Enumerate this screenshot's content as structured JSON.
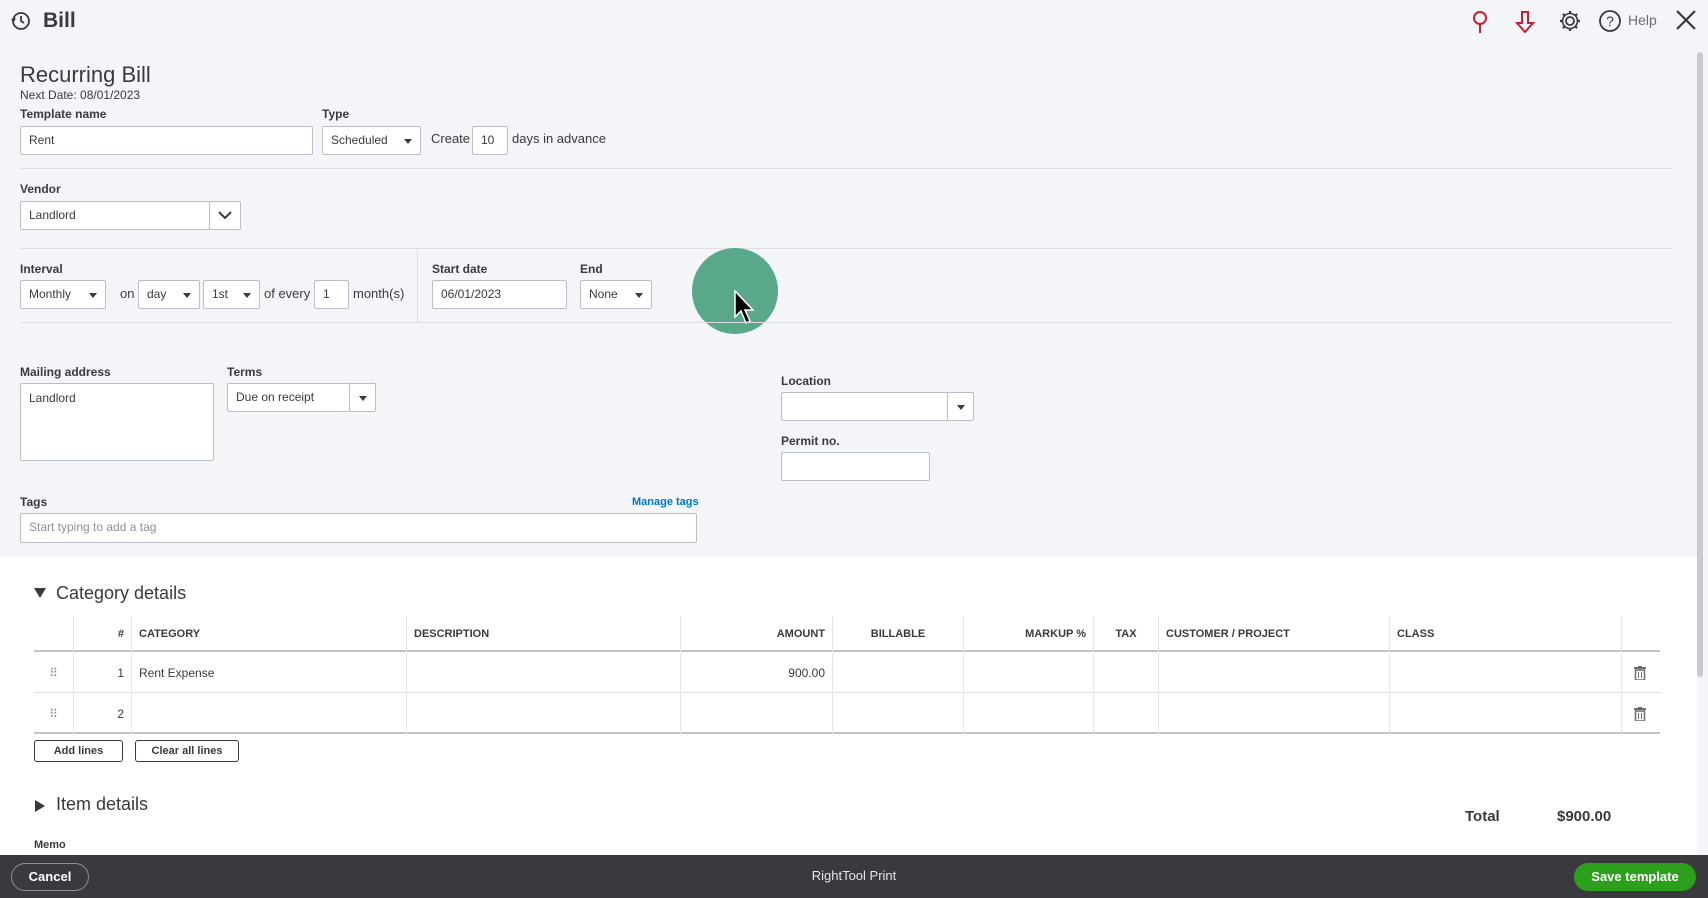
{
  "header": {
    "title": "Bill",
    "help_label": "Help"
  },
  "form": {
    "heading": "Recurring Bill",
    "next_date": "Next Date: 08/01/2023",
    "template_name_label": "Template name",
    "template_name_value": "Rent",
    "type_label": "Type",
    "type_value": "Scheduled",
    "create_label": "Create",
    "create_days_value": "10",
    "days_in_advance_label": "days in advance",
    "vendor_label": "Vendor",
    "vendor_value": "Landlord",
    "interval_label": "Interval",
    "interval_value": "Monthly",
    "on_label": "on",
    "on_value": "day",
    "day_value": "1st",
    "of_every_label": "of every",
    "every_value": "1",
    "months_label": "month(s)",
    "start_date_label": "Start date",
    "start_date_value": "06/01/2023",
    "end_label": "End",
    "end_value": "None",
    "mailing_address_label": "Mailing address",
    "mailing_address_value": "Landlord",
    "terms_label": "Terms",
    "terms_value": "Due on receipt",
    "location_label": "Location",
    "location_value": "",
    "permit_label": "Permit no.",
    "permit_value": "",
    "tags_label": "Tags",
    "manage_tags_label": "Manage tags",
    "tags_placeholder": "Start typing to add a tag"
  },
  "category_details": {
    "title": "Category details",
    "columns": [
      "#",
      "CATEGORY",
      "DESCRIPTION",
      "AMOUNT",
      "BILLABLE",
      "MARKUP %",
      "TAX",
      "CUSTOMER / PROJECT",
      "CLASS"
    ],
    "rows": [
      {
        "num": "1",
        "category": "Rent Expense",
        "amount": "900.00"
      },
      {
        "num": "2",
        "category": "",
        "amount": ""
      }
    ],
    "add_lines_label": "Add lines",
    "clear_lines_label": "Clear all lines"
  },
  "item_details": {
    "title": "Item details"
  },
  "totals": {
    "total_label": "Total",
    "total_value": "$900.00"
  },
  "memo_label": "Memo",
  "footer": {
    "cancel_label": "Cancel",
    "center_label": "RightTool Print",
    "save_label": "Save template"
  },
  "colors": {
    "accent_green": "#2ca01c",
    "link_blue": "#0077c5",
    "footer_bg": "#393a3d",
    "icon_red": "#c9202e"
  }
}
